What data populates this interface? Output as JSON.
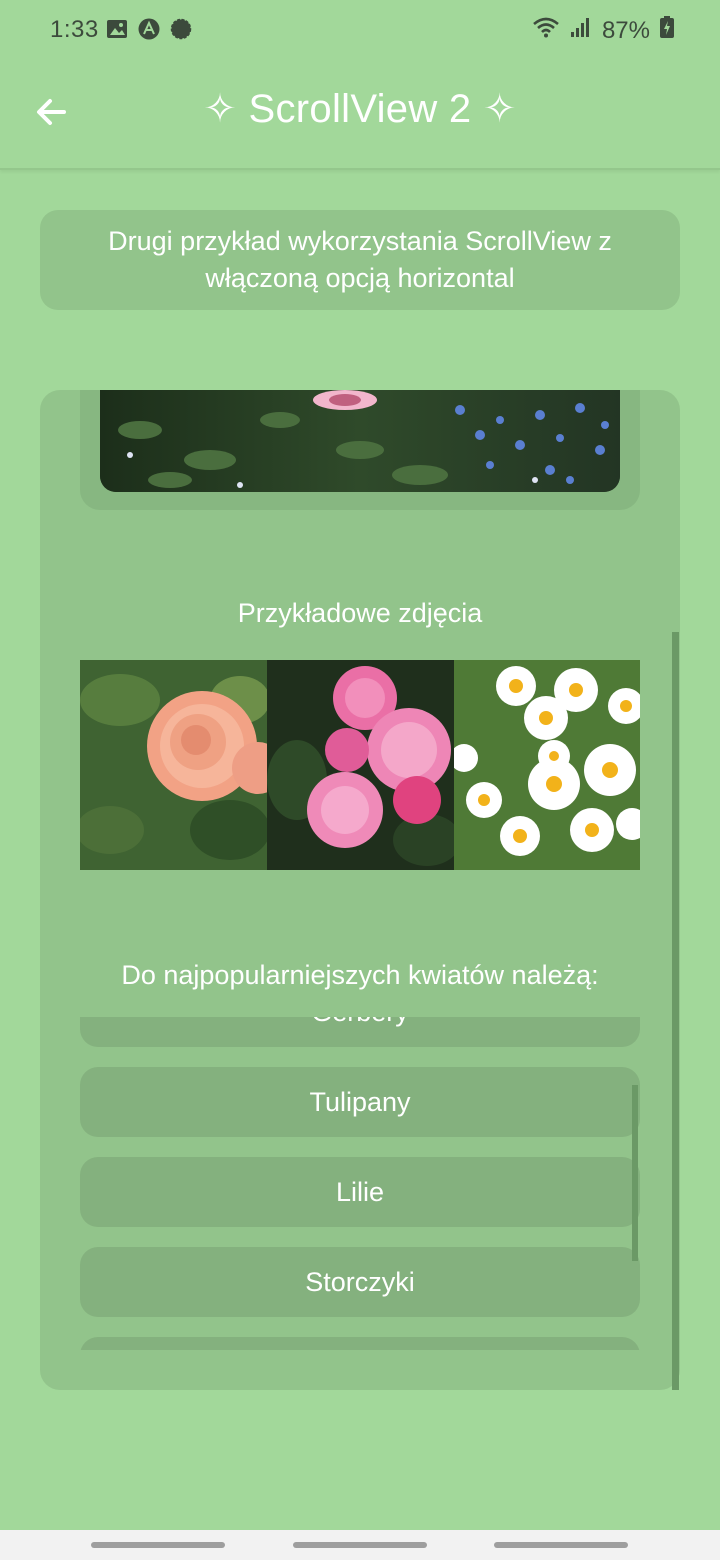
{
  "status_bar": {
    "time": "1:33",
    "battery": "87%",
    "icons": [
      "image-icon",
      "a-logo-icon",
      "signal-app-icon",
      "wifi-icon",
      "cell-signal-icon",
      "battery-icon"
    ]
  },
  "app_bar": {
    "title": "✧ ScrollView 2 ✧",
    "back_icon": "arrow-left-icon"
  },
  "info": {
    "text": "Drugi przykład wykorzystania ScrollView z włączoną opcją horizontal"
  },
  "gallery": {
    "label": "Przykładowe zdjęcia",
    "photos": [
      "peach-rose-photo",
      "pink-roses-photo",
      "daisies-photo"
    ]
  },
  "flowers": {
    "label": "Do najpopularniejszych kwiatów należą:",
    "items": [
      "Gerbery",
      "Tulipany",
      "Lilie",
      "Storczyki",
      ""
    ]
  },
  "colors": {
    "background": "#a2d89a",
    "card": "#92c48b",
    "list_item": "#84b17e",
    "text": "#ffffff"
  }
}
